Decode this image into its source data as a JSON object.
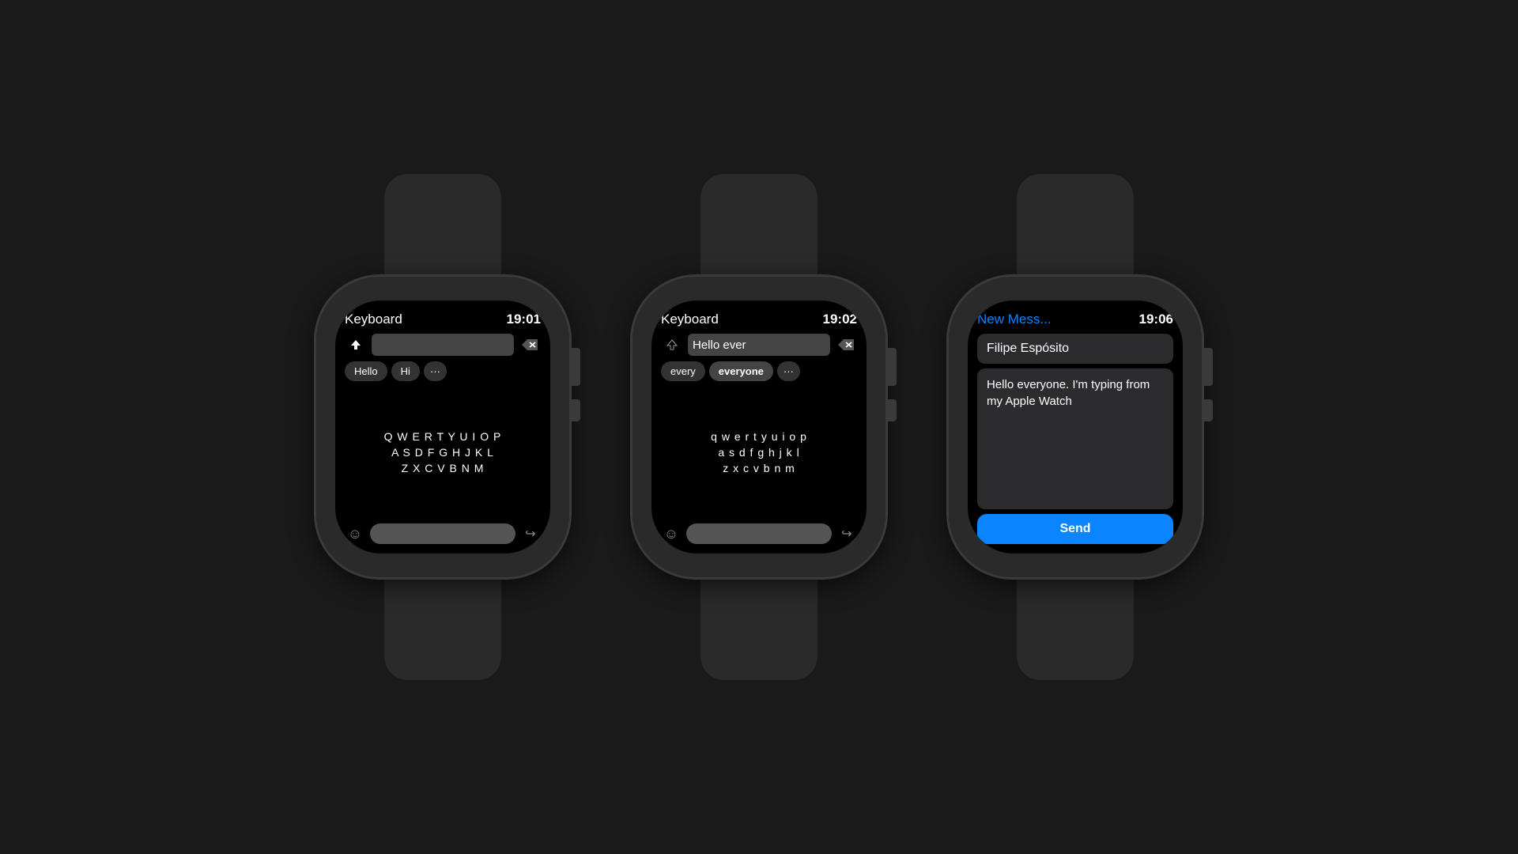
{
  "background": "#1a1a1a",
  "watches": [
    {
      "id": "watch1",
      "screen": "keyboard1",
      "header": {
        "title": "Keyboard",
        "time": "19:01"
      },
      "input": {
        "text": "",
        "placeholder": ""
      },
      "suggestions": [
        "Hello",
        "Hi",
        "···"
      ],
      "keyboard": {
        "rows": [
          "Q W E R T Y U I O P",
          "A S D F G H J K L",
          "Z X C V B N M"
        ]
      }
    },
    {
      "id": "watch2",
      "screen": "keyboard2",
      "header": {
        "title": "Keyboard",
        "time": "19:02"
      },
      "input": {
        "text": "Hello ever"
      },
      "suggestions": [
        "every",
        "everyone",
        "···"
      ],
      "keyboard": {
        "rows": [
          "q w e r t y u i o p",
          "a s d f g h j k l",
          "z x c v b n m"
        ]
      }
    },
    {
      "id": "watch3",
      "screen": "message",
      "header": {
        "title": "New Mess...",
        "time": "19:06"
      },
      "contact": "Filipe Espósito",
      "message": "Hello everyone. I'm typing from my Apple Watch",
      "send_label": "Send"
    }
  ],
  "icons": {
    "shift": "⬆",
    "delete": "⌫",
    "emoji": "☺",
    "send_arrow": "↪",
    "more": "···"
  }
}
